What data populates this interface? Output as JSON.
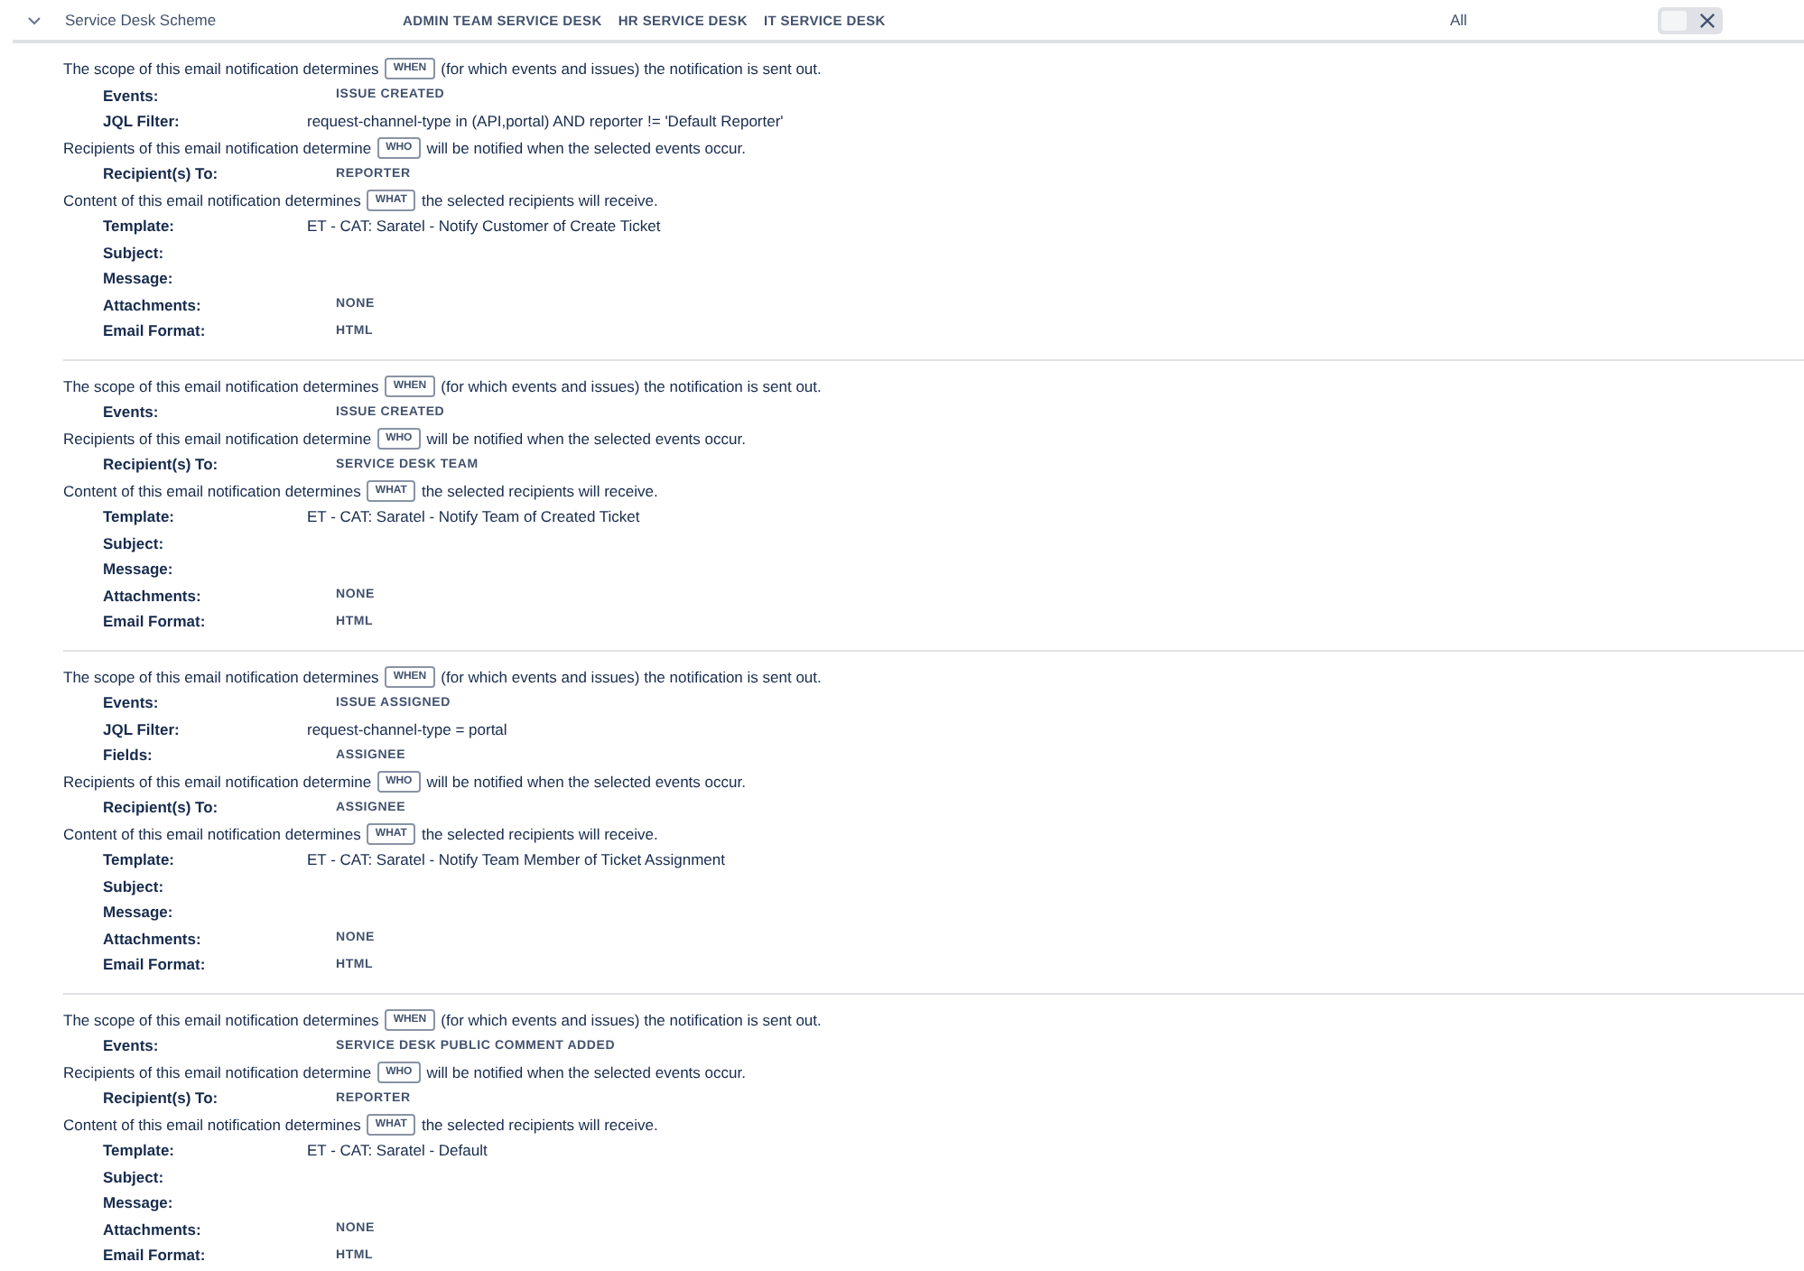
{
  "header": {
    "expanded": true,
    "scheme": "Service Desk Scheme",
    "projects": [
      "ADMIN TEAM SERVICE DESK",
      "HR SERVICE DESK",
      "IT SERVICE DESK"
    ],
    "scope": "All",
    "toggle": {
      "on": false
    }
  },
  "notifications": [
    {
      "lines": [
        {
          "kind": "sentence",
          "before": "The scope of this email notification determines",
          "badge": "WHEN",
          "after": "(for which events and issues) the notification is sent out."
        },
        {
          "kind": "tag",
          "label": "Events:",
          "value": "ISSUE CREATED"
        },
        {
          "kind": "text",
          "label": "JQL Filter:",
          "value": "request-channel-type in (API,portal) AND reporter != 'Default Reporter'"
        },
        {
          "kind": "sentence",
          "before": "Recipients of this email notification determine",
          "badge": "WHO",
          "after": "will be notified when the selected events occur."
        },
        {
          "kind": "tag",
          "label": "Recipient(s) To:",
          "value": "REPORTER"
        },
        {
          "kind": "sentence",
          "before": "Content of this email notification determines",
          "badge": "WHAT",
          "after": "the selected recipients will receive."
        },
        {
          "kind": "text",
          "label": "Template:",
          "value": "ET - CAT: Saratel - Notify Customer of Create Ticket"
        },
        {
          "kind": "empty",
          "label": "Subject:"
        },
        {
          "kind": "empty",
          "label": "Message:"
        },
        {
          "kind": "tag",
          "label": "Attachments:",
          "value": "NONE"
        },
        {
          "kind": "tag",
          "label": "Email Format:",
          "value": "HTML"
        }
      ]
    },
    {
      "lines": [
        {
          "kind": "sentence",
          "before": "The scope of this email notification determines",
          "badge": "WHEN",
          "after": "(for which events and issues) the notification is sent out."
        },
        {
          "kind": "tag",
          "label": "Events:",
          "value": "ISSUE CREATED"
        },
        {
          "kind": "sentence",
          "before": "Recipients of this email notification determine",
          "badge": "WHO",
          "after": "will be notified when the selected events occur."
        },
        {
          "kind": "tag",
          "label": "Recipient(s) To:",
          "value": "SERVICE DESK TEAM"
        },
        {
          "kind": "sentence",
          "before": "Content of this email notification determines",
          "badge": "WHAT",
          "after": "the selected recipients will receive."
        },
        {
          "kind": "text",
          "label": "Template:",
          "value": "ET - CAT: Saratel - Notify Team of Created Ticket"
        },
        {
          "kind": "empty",
          "label": "Subject:"
        },
        {
          "kind": "empty",
          "label": "Message:"
        },
        {
          "kind": "tag",
          "label": "Attachments:",
          "value": "NONE"
        },
        {
          "kind": "tag",
          "label": "Email Format:",
          "value": "HTML"
        }
      ]
    },
    {
      "lines": [
        {
          "kind": "sentence",
          "before": "The scope of this email notification determines",
          "badge": "WHEN",
          "after": "(for which events and issues) the notification is sent out."
        },
        {
          "kind": "tag",
          "label": "Events:",
          "value": "ISSUE ASSIGNED"
        },
        {
          "kind": "text",
          "label": "JQL Filter:",
          "value": "request-channel-type = portal"
        },
        {
          "kind": "tag",
          "label": "Fields:",
          "value": "ASSIGNEE"
        },
        {
          "kind": "sentence",
          "before": "Recipients of this email notification determine",
          "badge": "WHO",
          "after": "will be notified when the selected events occur."
        },
        {
          "kind": "tag",
          "label": "Recipient(s) To:",
          "value": "ASSIGNEE"
        },
        {
          "kind": "sentence",
          "before": "Content of this email notification determines",
          "badge": "WHAT",
          "after": "the selected recipients will receive."
        },
        {
          "kind": "text",
          "label": "Template:",
          "value": "ET - CAT: Saratel - Notify Team Member of Ticket Assignment"
        },
        {
          "kind": "empty",
          "label": "Subject:"
        },
        {
          "kind": "empty",
          "label": "Message:"
        },
        {
          "kind": "tag",
          "label": "Attachments:",
          "value": "NONE"
        },
        {
          "kind": "tag",
          "label": "Email Format:",
          "value": "HTML"
        }
      ]
    },
    {
      "lines": [
        {
          "kind": "sentence",
          "before": "The scope of this email notification determines",
          "badge": "WHEN",
          "after": "(for which events and issues) the notification is sent out."
        },
        {
          "kind": "tag",
          "label": "Events:",
          "value": "SERVICE DESK PUBLIC COMMENT ADDED"
        },
        {
          "kind": "sentence",
          "before": "Recipients of this email notification determine",
          "badge": "WHO",
          "after": "will be notified when the selected events occur."
        },
        {
          "kind": "tag",
          "label": "Recipient(s) To:",
          "value": "REPORTER"
        },
        {
          "kind": "sentence",
          "before": "Content of this email notification determines",
          "badge": "WHAT",
          "after": "the selected recipients will receive."
        },
        {
          "kind": "text",
          "label": "Template:",
          "value": "ET - CAT: Saratel - Default"
        },
        {
          "kind": "empty",
          "label": "Subject:"
        },
        {
          "kind": "empty",
          "label": "Message:"
        },
        {
          "kind": "tag",
          "label": "Attachments:",
          "value": "NONE"
        },
        {
          "kind": "tag",
          "label": "Email Format:",
          "value": "HTML"
        }
      ]
    }
  ]
}
